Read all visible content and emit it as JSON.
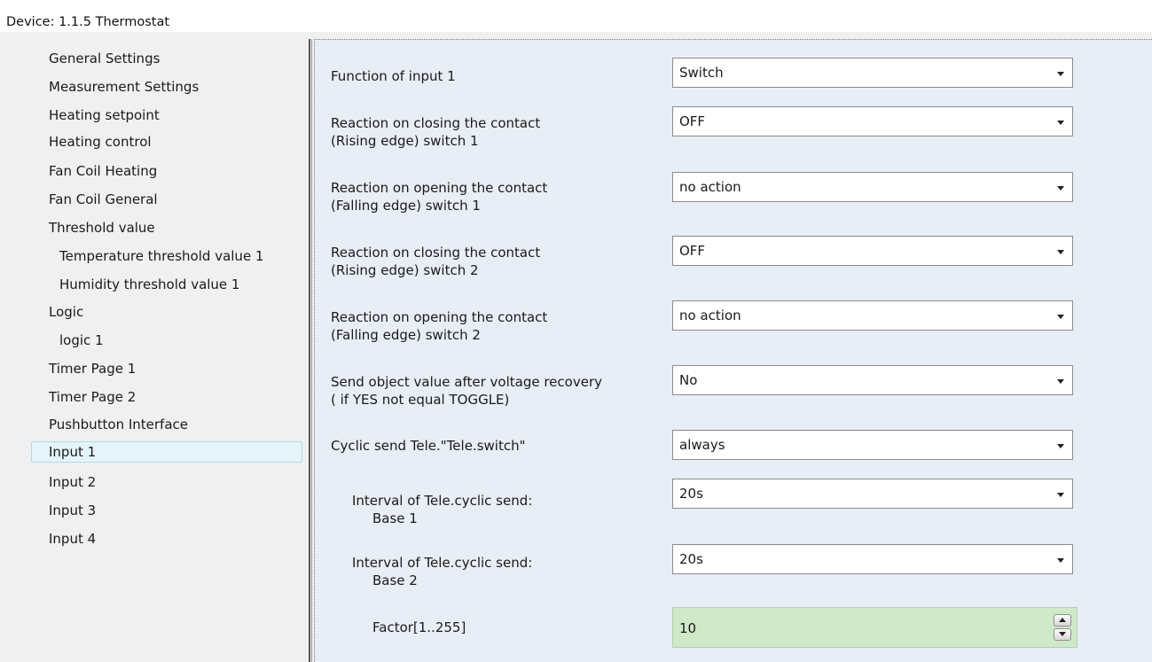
{
  "window": {
    "title": "Device: 1.1.5  Thermostat"
  },
  "sidebar": {
    "items": [
      {
        "label": "General Settings"
      },
      {
        "label": "Measurement Settings"
      },
      {
        "label": "Heating setpoint"
      },
      {
        "label": "Heating control"
      },
      {
        "label": "Fan Coil Heating"
      },
      {
        "label": "Fan Coil General"
      },
      {
        "label": "Threshold value"
      },
      {
        "label": "Temperature threshold value 1"
      },
      {
        "label": "Humidity threshold value 1"
      },
      {
        "label": "Logic"
      },
      {
        "label": "logic 1"
      },
      {
        "label": "Timer Page 1"
      },
      {
        "label": "Timer Page 2"
      },
      {
        "label": "Pushbutton Interface"
      },
      {
        "label": "Input 1",
        "selected": true
      },
      {
        "label": "Input 2"
      },
      {
        "label": "Input 3"
      },
      {
        "label": "Input 4"
      }
    ]
  },
  "params": [
    {
      "label1": "Function of input 1",
      "label2": "",
      "value": "Switch"
    },
    {
      "label1": "Reaction on closing the contact",
      "label2": "(Rising edge)  switch 1",
      "value": "OFF"
    },
    {
      "label1": "Reaction on opening the contact",
      "label2": "(Falling edge)  switch 1",
      "value": "no action"
    },
    {
      "label1": "Reaction on closing the contact",
      "label2": "(Rising edge)  switch 2",
      "value": "OFF"
    },
    {
      "label1": "Reaction on opening the contact",
      "label2": "(Falling edge)  switch 2",
      "value": "no action"
    },
    {
      "label1": "Send object value after voltage recovery",
      "label2": "( if YES not equal TOGGLE)",
      "value": "No"
    },
    {
      "label1": "Cyclic send Tele.\"Tele.switch\"",
      "label2": "",
      "value": "always"
    },
    {
      "label1": "Interval of Tele.cyclic send:",
      "label2": "Base 1",
      "value": "20s"
    },
    {
      "label1": "Interval of Tele.cyclic send:",
      "label2": "Base 2",
      "value": "20s"
    }
  ],
  "factor": {
    "label": "Factor[1..255]",
    "value": "10"
  },
  "colors": {
    "panel_bg": "#e8eef5",
    "selected_bg": "#e5f3fb",
    "spin_bg": "#cfe8c8"
  }
}
